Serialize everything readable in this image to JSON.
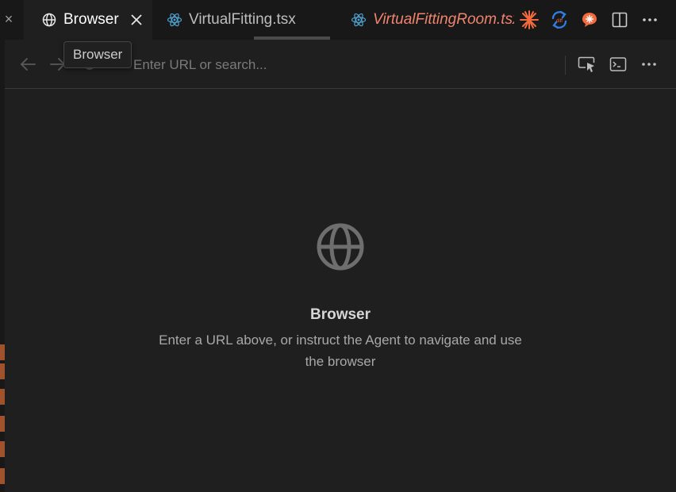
{
  "tabs": [
    {
      "label": "Browser",
      "icon": "globe-icon",
      "active": true
    },
    {
      "label": "VirtualFitting.tsx",
      "icon": "react-icon",
      "active": false
    },
    {
      "label": "VirtualFittingRoom.tsx",
      "icon": "react-icon",
      "active": false
    }
  ],
  "tab_actions": [
    "sparkle-icon",
    "diff-sync-icon",
    "chat-icon",
    "split-editor-icon",
    "more-icon"
  ],
  "tooltip": {
    "text": "Browser"
  },
  "toolbar": {
    "url_placeholder": "Enter URL or search...",
    "url_value": ""
  },
  "empty_state": {
    "title": "Browser",
    "description": "Enter a URL above, or instruct the Agent to navigate and use the browser"
  },
  "colors": {
    "background": "#1f1f1f",
    "tab_bar": "#181818",
    "italic_tab": "#f0846e",
    "react_icon": "#4fa3d1",
    "accent_orange": "#f26a3d",
    "accent_blue": "#2f7de1",
    "gutter_mark": "#a0522d"
  }
}
